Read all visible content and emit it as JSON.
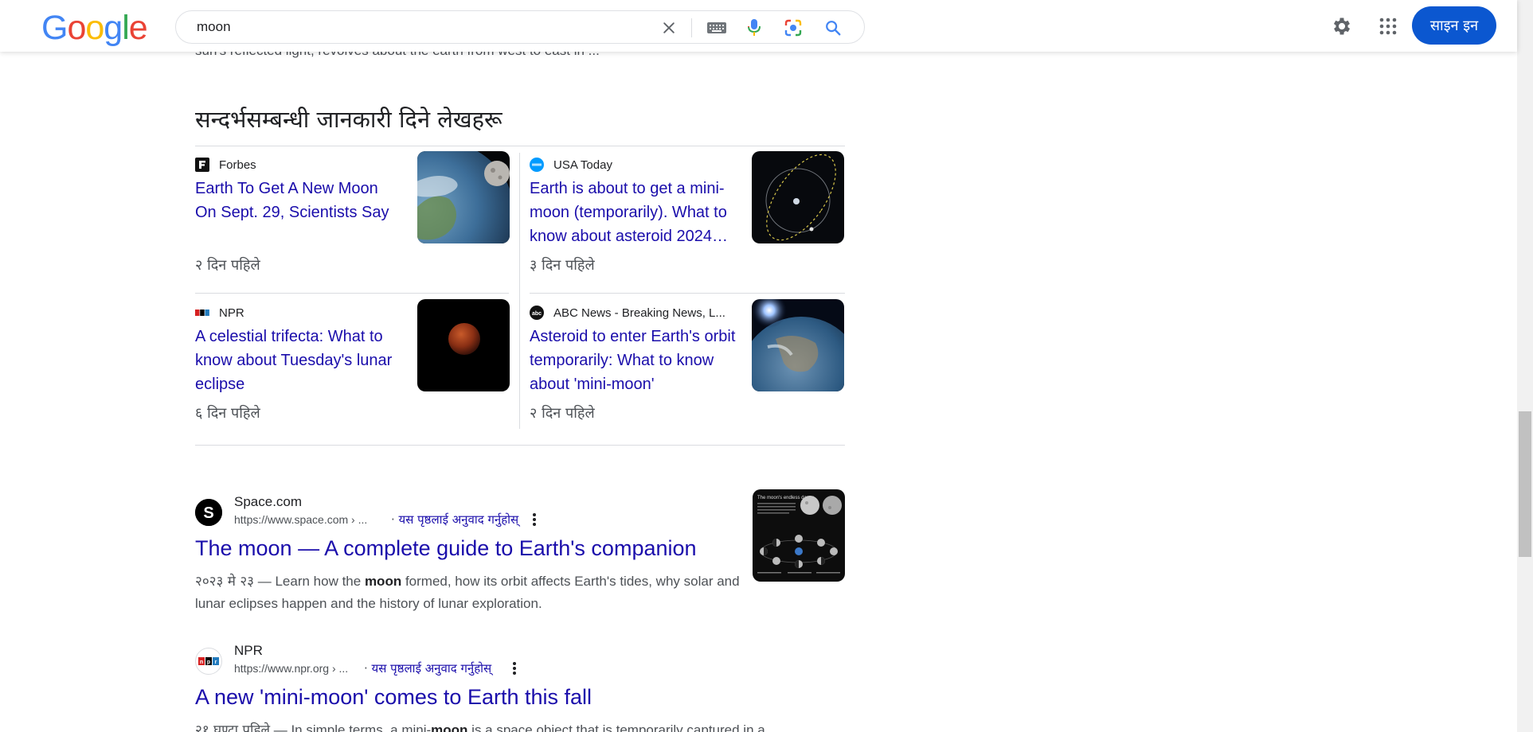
{
  "header": {
    "logo_letters": [
      "G",
      "o",
      "o",
      "g",
      "l",
      "e"
    ],
    "search_value": "moon",
    "signin_label": "साइन इन",
    "icons": [
      "close-icon",
      "keyboard-icon",
      "mic-icon",
      "lens-icon",
      "search-icon",
      "settings-icon",
      "apps-icon"
    ]
  },
  "cutoff_text": "sun's reflected light, revolves about the earth from west to east in ...",
  "section_title": "सन्दर्भसम्बन्धी जानकारी दिने लेखहरू",
  "cards": [
    {
      "source": "Forbes",
      "headline": "Earth To Get A New Moon On Sept. 29, Scientists Say",
      "ago": "२ दिन पहिले"
    },
    {
      "source": "USA Today",
      "headline": "Earth is about to get a mini-moon (temporarily). What to know about asteroid 2024…",
      "ago": "३ दिन पहिले"
    },
    {
      "source": "NPR",
      "headline": "A celestial trifecta: What to know about Tuesday's lunar eclipse",
      "ago": "६ दिन पहिले"
    },
    {
      "source": "ABC News - Breaking News, L...",
      "headline": "Asteroid to enter Earth's orbit temporarily: What to know about 'mini-moon'",
      "ago": "२ दिन पहिले"
    }
  ],
  "results": [
    {
      "site": "Space.com",
      "url": "https://www.space.com › ...",
      "translate": "यस पृष्ठलाई अनुवाद गर्नुहोस्",
      "title": "The moon — A complete guide to Earth's companion",
      "date": "२०२३ मे २३",
      "snippet_pre": " — Learn how the ",
      "snippet_bold": "moon",
      "snippet_post": " formed, how its orbit affects Earth's tides, why solar and lunar eclipses happen and the history of lunar exploration.",
      "thumb_title": "The moon's endless dance"
    },
    {
      "site": "NPR",
      "url": "https://www.npr.org › ...",
      "translate": "यस पृष्ठलाई अनुवाद गर्नुहोस्",
      "title": "A new 'mini-moon' comes to Earth this fall",
      "date": "२१ घण्टा पहिले",
      "snippet_pre": " — In simple terms, a mini-",
      "snippet_bold": "moon",
      "snippet_post": " is a space object that is temporarily captured in a"
    }
  ],
  "colors": {
    "link": "#1a0dab",
    "signin": "#0b57d0",
    "google_blue": "#4285f4",
    "google_red": "#ea4335",
    "google_yellow": "#fbbc05",
    "google_green": "#34a853"
  }
}
